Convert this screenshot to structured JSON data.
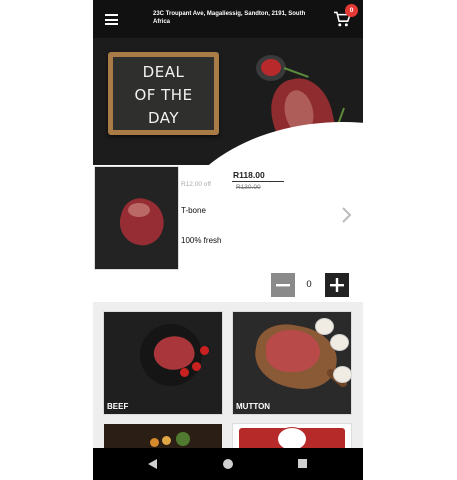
{
  "header": {
    "address": "23C Troupant Ave, Magaliessig, Sandton, 2191, South Africa",
    "cart_count": "0"
  },
  "hero": {
    "board_lines": [
      "DEAL",
      "OF THE",
      "DAY"
    ]
  },
  "deal": {
    "price": "R118.00",
    "old_price": "R130.00",
    "off_text": "R12.00 off",
    "name": "T-bone",
    "description": "100% fresh",
    "quantity": "0"
  },
  "categories": [
    {
      "label": "BEEF"
    },
    {
      "label": "MUTTON"
    }
  ],
  "colors": {
    "badge": "#e53935",
    "topbar": "#111111",
    "minus_button": "#8a8a8a",
    "plus_button": "#222222"
  },
  "icons": {
    "menu": "hamburger-menu-icon",
    "cart": "shopping-cart-icon",
    "next": "chevron-right-icon",
    "back": "triangle-back-icon",
    "home": "circle-home-icon",
    "recent": "square-recent-icon"
  }
}
